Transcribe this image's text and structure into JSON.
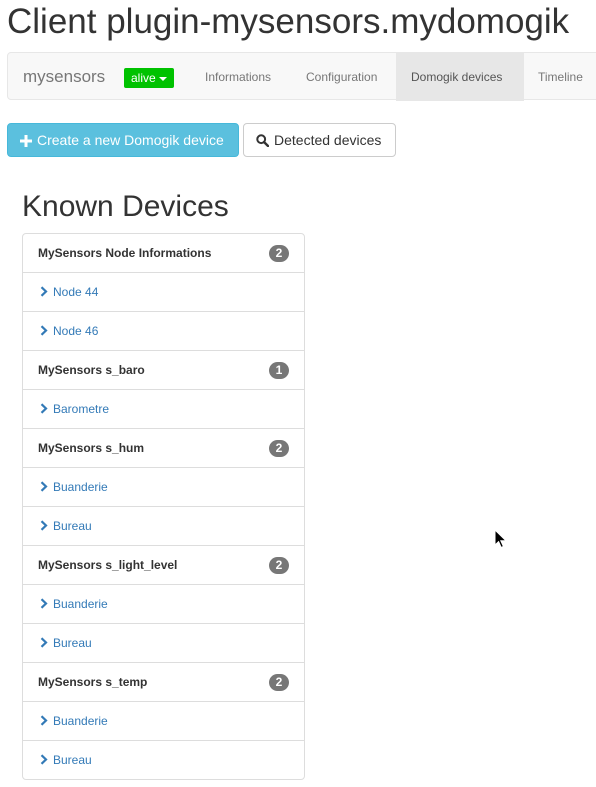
{
  "page": {
    "title": "Client plugin-mysensors.mydomogik"
  },
  "navbar": {
    "brand": "mysensors",
    "status": "alive",
    "status_color": "#00c200",
    "tabs": [
      {
        "label": "Informations",
        "active": false
      },
      {
        "label": "Configuration",
        "active": false
      },
      {
        "label": "Domogik devices",
        "active": true
      },
      {
        "label": "Timeline",
        "active": false
      }
    ]
  },
  "actions": {
    "create_label": "Create a new Domogik device",
    "create_icon": "plus-icon",
    "detected_label": "Detected devices",
    "detected_icon": "search-icon"
  },
  "known_devices": {
    "title": "Known Devices",
    "groups": [
      {
        "name": "MySensors Node Informations",
        "count": "2",
        "devices": [
          "Node 44",
          "Node 46"
        ]
      },
      {
        "name": "MySensors s_baro",
        "count": "1",
        "devices": [
          "Barometre"
        ]
      },
      {
        "name": "MySensors s_hum",
        "count": "2",
        "devices": [
          "Buanderie",
          "Bureau"
        ]
      },
      {
        "name": "MySensors s_light_level",
        "count": "2",
        "devices": [
          "Buanderie",
          "Bureau"
        ]
      },
      {
        "name": "MySensors s_temp",
        "count": "2",
        "devices": [
          "Buanderie",
          "Bureau"
        ]
      }
    ]
  },
  "colors": {
    "accent": "#5bc0de",
    "link": "#337ab7",
    "badge": "#777777"
  }
}
